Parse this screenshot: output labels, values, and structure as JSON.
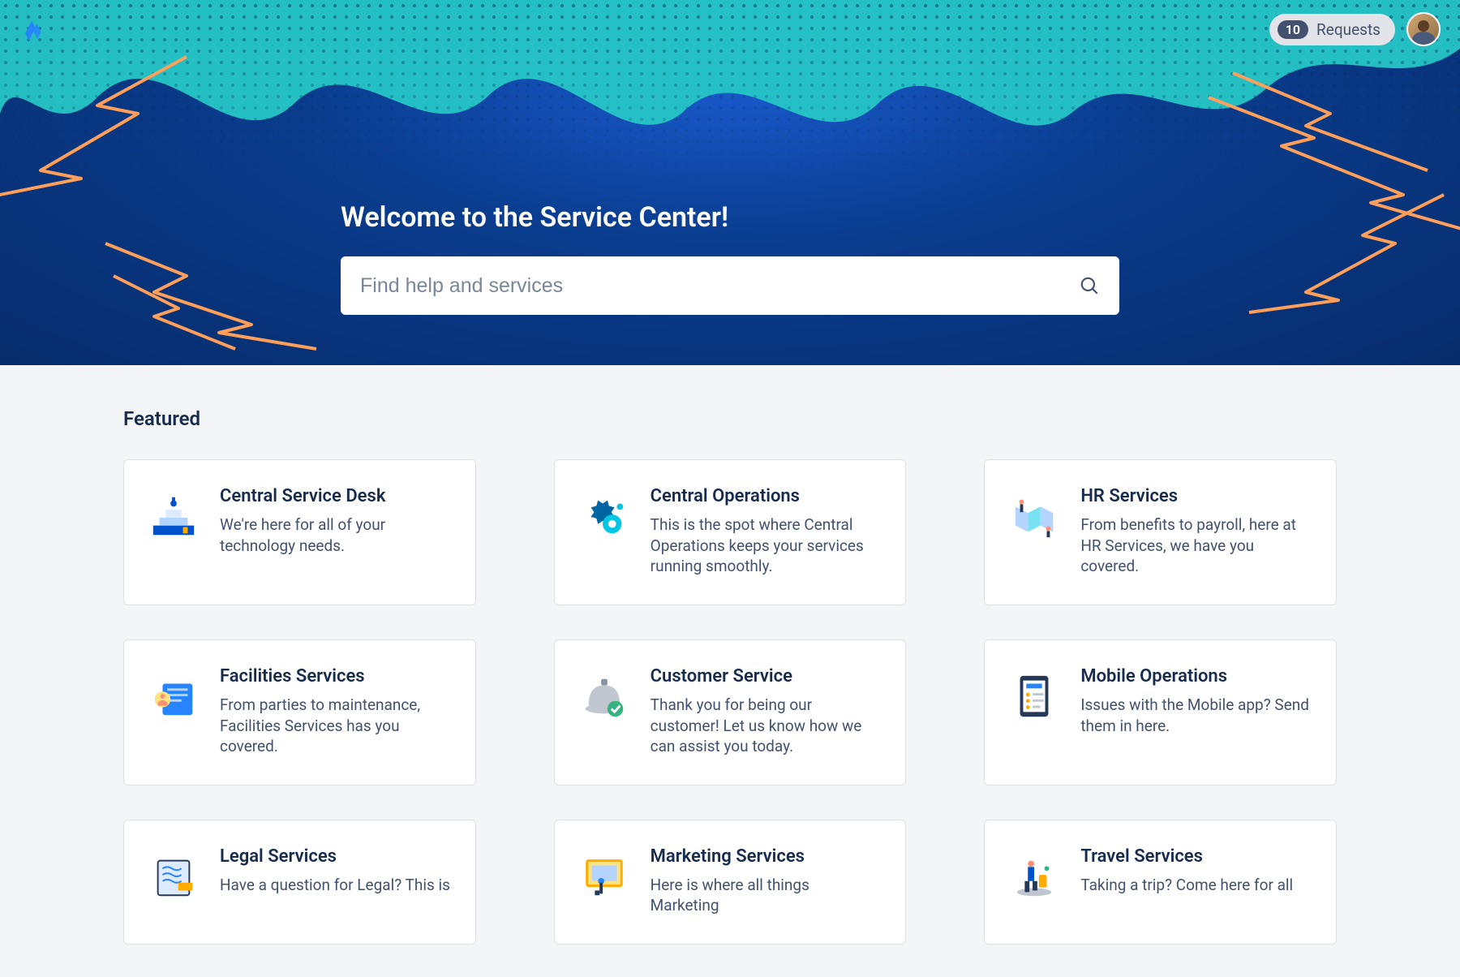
{
  "header": {
    "requests_label": "Requests",
    "requests_count": "10"
  },
  "hero": {
    "title": "Welcome to the Service Center!",
    "search_placeholder": "Find help and services"
  },
  "featured": {
    "heading": "Featured",
    "cards": [
      {
        "title": "Central Service Desk",
        "desc": "We're here for all of your technology needs."
      },
      {
        "title": "Central Operations",
        "desc": "This is the spot where Central Operations keeps your services running smoothly."
      },
      {
        "title": "HR Services",
        "desc": "From benefits to payroll, here at HR Services, we have you covered."
      },
      {
        "title": "Facilities Services",
        "desc": "From parties to maintenance, Facilities Services has you covered."
      },
      {
        "title": "Customer Service",
        "desc": "Thank you for being our customer! Let us know how we can assist you today."
      },
      {
        "title": "Mobile Operations",
        "desc": "Issues with the Mobile app? Send them in here."
      },
      {
        "title": "Legal Services",
        "desc": "Have a question for Legal? This is"
      },
      {
        "title": "Marketing Services",
        "desc": "Here is where all things Marketing"
      },
      {
        "title": "Travel Services",
        "desc": "Taking a trip? Come here for all"
      }
    ]
  }
}
